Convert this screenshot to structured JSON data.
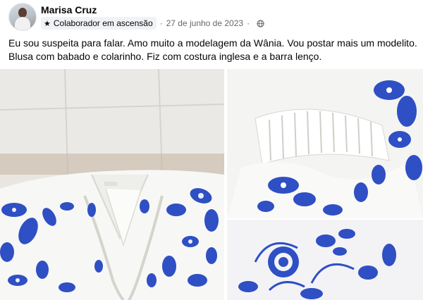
{
  "post": {
    "author": "Marisa Cruz",
    "badge": "Colaborador em ascensão",
    "separator": "·",
    "date": "27 de junho de 2023",
    "privacy_icon": "globe-icon",
    "text_lines": [
      "Eu sou suspeita para falar. Amo muito a modelagem da Wânia. Vou postar mais um modelito.",
      "Blusa com babado e colarinho. Fiz com costura inglesa e a barra lenço."
    ]
  },
  "colors": {
    "text": "#050505",
    "secondary_text": "#65676b",
    "badge_bg": "#f0f2f5",
    "print_blue": "#2f4fc4"
  }
}
